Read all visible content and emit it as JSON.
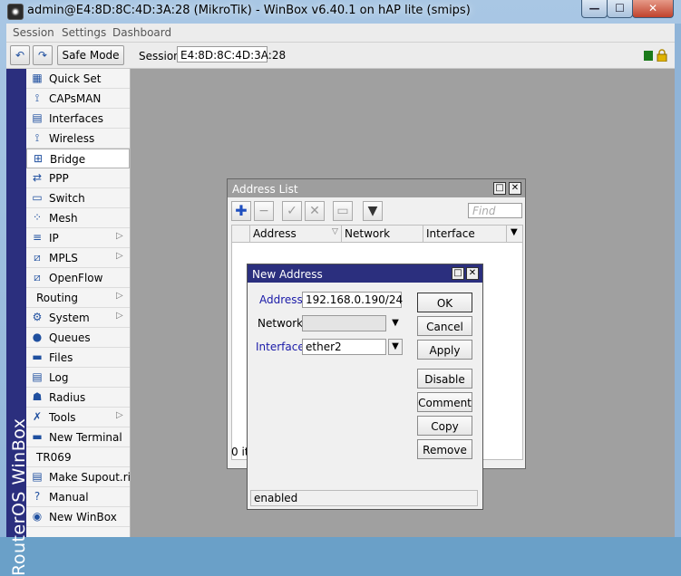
{
  "window": {
    "title": "admin@E4:8D:8C:4D:3A:28 (MikroTik) - WinBox v6.40.1 on hAP lite (smips)",
    "min_glyph": "—",
    "max_glyph": "☐",
    "close_glyph": "✕"
  },
  "menubar": {
    "items": [
      {
        "label": "Session"
      },
      {
        "label": "Settings"
      },
      {
        "label": "Dashboard"
      }
    ]
  },
  "toolbar": {
    "undo_glyph": "↶",
    "redo_glyph": "↷",
    "safe_mode_label": "Safe Mode",
    "session_label": "Session:",
    "session_value": "E4:8D:8C:4D:3A:28"
  },
  "brand_strip": "RouterOS WinBox",
  "sidebar": {
    "items": [
      {
        "label": "Quick Set",
        "icon": "quick-set-icon"
      },
      {
        "label": "CAPsMAN",
        "icon": "capsman-icon"
      },
      {
        "label": "Interfaces",
        "icon": "interfaces-icon"
      },
      {
        "label": "Wireless",
        "icon": "wireless-icon"
      },
      {
        "label": "Bridge",
        "icon": "bridge-icon"
      },
      {
        "label": "PPP",
        "icon": "ppp-icon"
      },
      {
        "label": "Switch",
        "icon": "switch-icon"
      },
      {
        "label": "Mesh",
        "icon": "mesh-icon"
      },
      {
        "label": "IP",
        "icon": "ip-icon",
        "submenu": true
      },
      {
        "label": "MPLS",
        "icon": "mpls-icon",
        "submenu": true
      },
      {
        "label": "OpenFlow",
        "icon": "openflow-icon"
      },
      {
        "label": "Routing",
        "icon": "",
        "submenu": true
      },
      {
        "label": "System",
        "icon": "system-icon",
        "submenu": true
      },
      {
        "label": "Queues",
        "icon": "queues-icon"
      },
      {
        "label": "Files",
        "icon": "files-icon"
      },
      {
        "label": "Log",
        "icon": "log-icon"
      },
      {
        "label": "Radius",
        "icon": "radius-icon"
      },
      {
        "label": "Tools",
        "icon": "tools-icon",
        "submenu": true
      },
      {
        "label": "New Terminal",
        "icon": "terminal-icon"
      },
      {
        "label": "TR069",
        "icon": ""
      },
      {
        "label": "Make Supout.rif",
        "icon": "supout-icon"
      },
      {
        "label": "Manual",
        "icon": "manual-icon"
      },
      {
        "label": "New WinBox",
        "icon": "winbox-icon"
      }
    ],
    "active": "Bridge"
  },
  "address_list": {
    "title": "Address List",
    "find_placeholder": "Find",
    "columns": [
      "Address",
      "Network",
      "Interface"
    ],
    "items_count_text": "0 it"
  },
  "new_address": {
    "title": "New Address",
    "address_label": "Address:",
    "address_value": "192.168.0.190/24",
    "network_label": "Network:",
    "network_value": "",
    "interface_label": "Interface:",
    "interface_value": "ether2",
    "buttons": {
      "ok": "OK",
      "cancel": "Cancel",
      "apply": "Apply",
      "disable": "Disable",
      "comment": "Comment",
      "copy": "Copy",
      "remove": "Remove"
    },
    "status": "enabled"
  },
  "colors": {
    "sidebar_strip": "#2b2f7e",
    "dialog_title_active": "#2b2f7e",
    "dialog_title_inactive": "#9e9e9e",
    "workspace": "#a0a0a0"
  }
}
